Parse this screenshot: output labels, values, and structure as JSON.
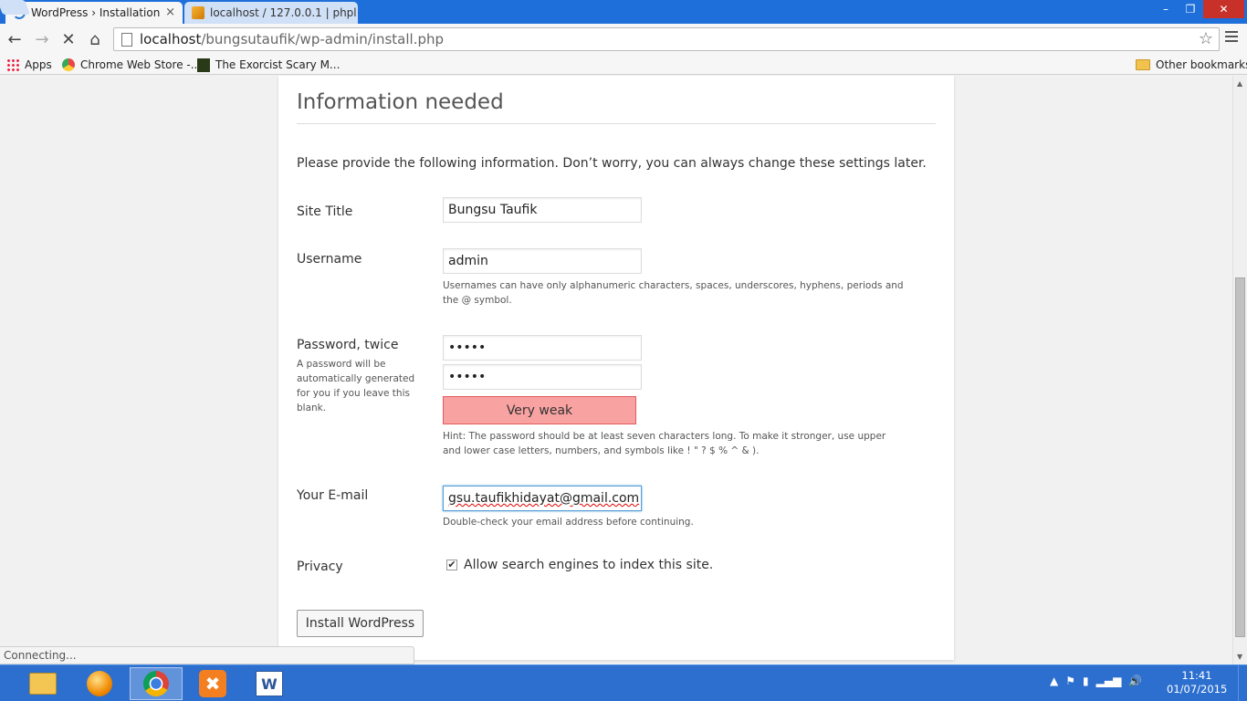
{
  "browser": {
    "tabs": [
      {
        "title": "WordPress › Installation"
      },
      {
        "title": "localhost / 127.0.0.1 | phpl"
      }
    ],
    "close_glyph": "×",
    "window_controls": {
      "minimize": "–",
      "maximize": "❐",
      "close": "✕"
    },
    "toolbar": {
      "back_glyph": "←",
      "forward_glyph": "→",
      "stop_glyph": "✕",
      "home_glyph": "⌂",
      "url_host": "localhost",
      "url_path": "/bungsutaufik/wp-admin/install.php",
      "star_glyph": "☆"
    },
    "bookmarks": [
      {
        "label": "Apps"
      },
      {
        "label": "Chrome Web Store -..."
      },
      {
        "label": "The Exorcist Scary M..."
      }
    ],
    "other_bookmarks": "Other bookmarks",
    "status": "Connecting..."
  },
  "page": {
    "heading": "Information needed",
    "intro": "Please provide the following information. Don’t worry, you can always change these settings later.",
    "site_title": {
      "label": "Site Title",
      "value": "Bungsu Taufik"
    },
    "username": {
      "label": "Username",
      "value": "admin",
      "hint": "Usernames can have only alphanumeric characters, spaces, underscores, hyphens, periods and the @ symbol."
    },
    "password": {
      "label": "Password, twice",
      "label_hint": "A password will be automatically generated for you if you leave this blank.",
      "value1": "•••••",
      "value2": "•••••",
      "strength": "Very weak",
      "hint": "Hint: The password should be at least seven characters long. To make it stronger, use upper and lower case letters, numbers, and symbols like ! \" ? $ % ^ & )."
    },
    "email": {
      "label": "Your E-mail",
      "value": "gsu.taufikhidayat@gmail.com",
      "hint": "Double-check your email address before continuing."
    },
    "privacy": {
      "label": "Privacy",
      "checkbox_label": "Allow search engines to index this site.",
      "checked": true,
      "check_glyph": "✔"
    },
    "install_button": "Install WordPress"
  },
  "scrollbar": {
    "up_glyph": "▲",
    "down_glyph": "▼"
  },
  "taskbar": {
    "xampp_glyph": "✖",
    "word_glyph": "W",
    "tray": {
      "chevron": "▲",
      "flag": "⚑",
      "battery": "▮",
      "signal": "▂▄▆",
      "volume": "🔊"
    },
    "time": "11:41",
    "date": "01/07/2015"
  },
  "colors": {
    "titlebar": "#1e6fd9",
    "taskbar": "#2c6fcf",
    "strength_bg": "#f9a2a2",
    "strength_border": "#e35b5b",
    "focus_border": "#5b9dd9"
  }
}
